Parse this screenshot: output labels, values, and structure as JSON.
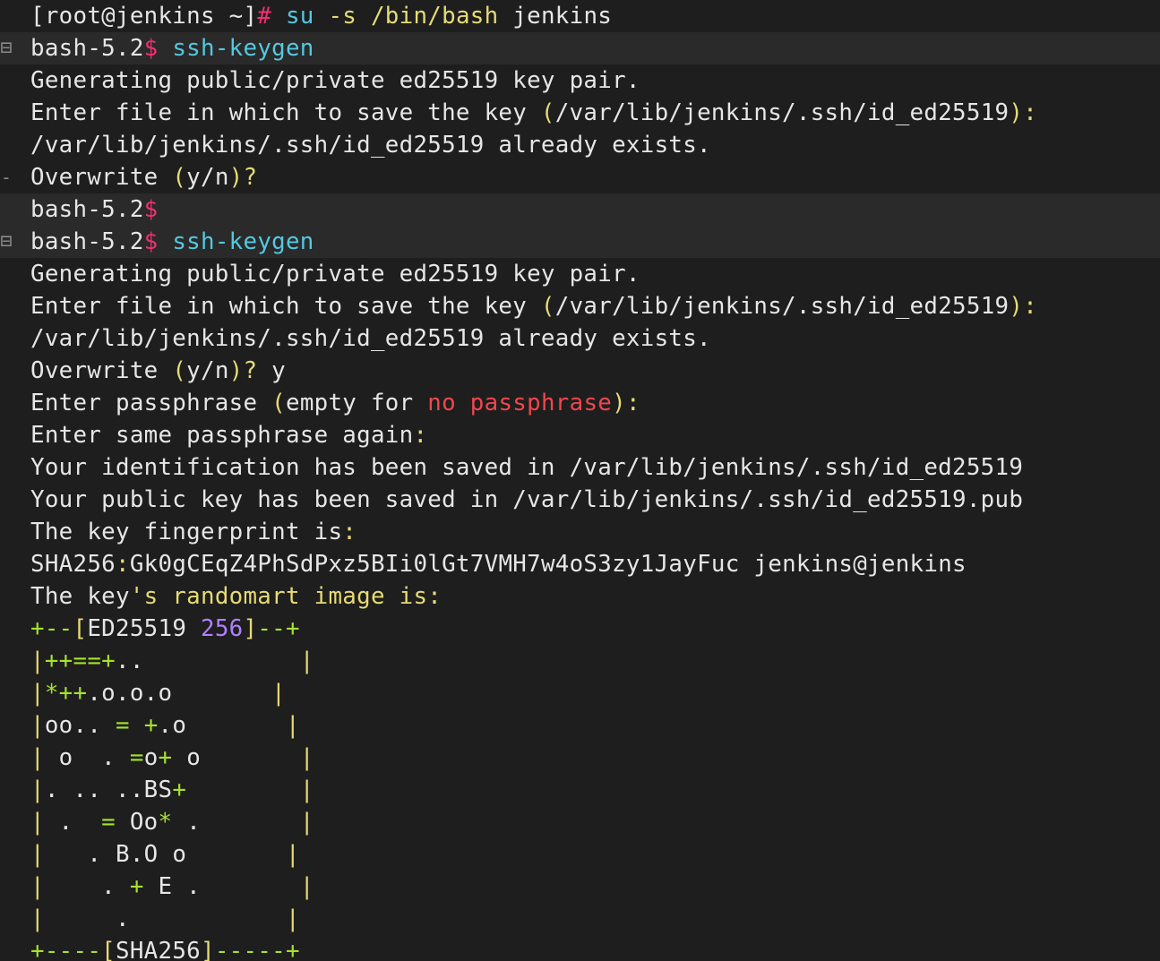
{
  "terminal": {
    "colors": {
      "background": "#1e1e1e",
      "highlight": "#2a2a2a",
      "text": "#e6e6e6",
      "prompt_symbol": "#f0306e",
      "command": "#54c8e0",
      "punctuation": "#e6db74",
      "randomart": "#a6e22e",
      "warning": "#f2464c",
      "number": "#ae81ff"
    },
    "gutter_marks": {
      "fold": "⊟",
      "dash": "-"
    },
    "lines": [
      {
        "highlight": false,
        "gutter": "",
        "segments": [
          {
            "text": "[root@jenkins ~]",
            "color": "white"
          },
          {
            "text": "#",
            "color": "pink"
          },
          {
            "text": " su ",
            "color": "cyan"
          },
          {
            "text": "-s /bin/bash",
            "color": "yellow"
          },
          {
            "text": " jenkins",
            "color": "white"
          }
        ]
      },
      {
        "highlight": true,
        "gutter": "fold",
        "segments": [
          {
            "text": "bash-5.2",
            "color": "white"
          },
          {
            "text": "$",
            "color": "pink"
          },
          {
            "text": " ssh-keygen",
            "color": "cyan"
          }
        ]
      },
      {
        "highlight": false,
        "gutter": "",
        "segments": [
          {
            "text": "Generating public/private ed25519 key pair.",
            "color": "white"
          }
        ]
      },
      {
        "highlight": false,
        "gutter": "",
        "segments": [
          {
            "text": "Enter file in which to save the key ",
            "color": "white"
          },
          {
            "text": "(",
            "color": "yellow"
          },
          {
            "text": "/var/lib/jenkins/.ssh/id_ed25519",
            "color": "white"
          },
          {
            "text": "):",
            "color": "yellow"
          }
        ]
      },
      {
        "highlight": false,
        "gutter": "",
        "segments": [
          {
            "text": "/var/lib/jenkins/.ssh/id_ed25519 already exists.",
            "color": "white"
          }
        ]
      },
      {
        "highlight": false,
        "gutter": "dash",
        "segments": [
          {
            "text": "Overwrite ",
            "color": "white"
          },
          {
            "text": "(",
            "color": "yellow"
          },
          {
            "text": "y/n",
            "color": "white"
          },
          {
            "text": ")?",
            "color": "yellow"
          }
        ]
      },
      {
        "highlight": true,
        "gutter": "",
        "segments": [
          {
            "text": "bash-5.2",
            "color": "white"
          },
          {
            "text": "$",
            "color": "pink"
          }
        ]
      },
      {
        "highlight": true,
        "gutter": "fold",
        "segments": [
          {
            "text": "bash-5.2",
            "color": "white"
          },
          {
            "text": "$",
            "color": "pink"
          },
          {
            "text": " ssh-keygen",
            "color": "cyan"
          }
        ]
      },
      {
        "highlight": false,
        "gutter": "",
        "segments": [
          {
            "text": "Generating public/private ed25519 key pair.",
            "color": "white"
          }
        ]
      },
      {
        "highlight": false,
        "gutter": "",
        "segments": [
          {
            "text": "Enter file in which to save the key ",
            "color": "white"
          },
          {
            "text": "(",
            "color": "yellow"
          },
          {
            "text": "/var/lib/jenkins/.ssh/id_ed25519",
            "color": "white"
          },
          {
            "text": "):",
            "color": "yellow"
          }
        ]
      },
      {
        "highlight": false,
        "gutter": "",
        "segments": [
          {
            "text": "/var/lib/jenkins/.ssh/id_ed25519 already exists.",
            "color": "white"
          }
        ]
      },
      {
        "highlight": false,
        "gutter": "",
        "segments": [
          {
            "text": "Overwrite ",
            "color": "white"
          },
          {
            "text": "(",
            "color": "yellow"
          },
          {
            "text": "y/n",
            "color": "white"
          },
          {
            "text": ")?",
            "color": "yellow"
          },
          {
            "text": " y",
            "color": "white"
          }
        ]
      },
      {
        "highlight": false,
        "gutter": "",
        "segments": [
          {
            "text": "Enter passphrase ",
            "color": "white"
          },
          {
            "text": "(",
            "color": "yellow"
          },
          {
            "text": "empty for ",
            "color": "white"
          },
          {
            "text": "no passphrase",
            "color": "red"
          },
          {
            "text": "):",
            "color": "yellow"
          }
        ]
      },
      {
        "highlight": false,
        "gutter": "",
        "segments": [
          {
            "text": "Enter same passphrase again",
            "color": "white"
          },
          {
            "text": ":",
            "color": "yellow"
          }
        ]
      },
      {
        "highlight": false,
        "gutter": "",
        "segments": [
          {
            "text": "Your identification has been saved in /var/lib/jenkins/.ssh/id_ed25519",
            "color": "white"
          }
        ]
      },
      {
        "highlight": false,
        "gutter": "",
        "segments": [
          {
            "text": "Your public key has been saved in /var/lib/jenkins/.ssh/id_ed25519.pub",
            "color": "white"
          }
        ]
      },
      {
        "highlight": false,
        "gutter": "",
        "segments": [
          {
            "text": "The key fingerprint is",
            "color": "white"
          },
          {
            "text": ":",
            "color": "yellow"
          }
        ]
      },
      {
        "highlight": false,
        "gutter": "",
        "segments": [
          {
            "text": "SHA256",
            "color": "white"
          },
          {
            "text": ":",
            "color": "yellow"
          },
          {
            "text": "Gk0gCEqZ4PhSdPxz5BIi0lGt7VMH7w4oS3zy1JayFuc jenkins@jenkins",
            "color": "white"
          }
        ]
      },
      {
        "highlight": false,
        "gutter": "",
        "segments": [
          {
            "text": "The key",
            "color": "white"
          },
          {
            "text": "'s randomart image is:",
            "color": "yellow"
          }
        ]
      },
      {
        "highlight": false,
        "gutter": "",
        "segments": [
          {
            "text": "+--",
            "color": "lime"
          },
          {
            "text": "[",
            "color": "yellow"
          },
          {
            "text": "ED25519 ",
            "color": "white"
          },
          {
            "text": "256",
            "color": "purple"
          },
          {
            "text": "]",
            "color": "yellow"
          },
          {
            "text": "--+",
            "color": "lime"
          }
        ]
      },
      {
        "highlight": false,
        "gutter": "",
        "segments": [
          {
            "text": "|",
            "color": "yellow"
          },
          {
            "text": "++==+",
            "color": "lime"
          },
          {
            "text": "..           ",
            "color": "white"
          },
          {
            "text": "|",
            "color": "yellow"
          }
        ]
      },
      {
        "highlight": false,
        "gutter": "",
        "segments": [
          {
            "text": "|",
            "color": "yellow"
          },
          {
            "text": "*++",
            "color": "lime"
          },
          {
            "text": ".o.o.o       ",
            "color": "white"
          },
          {
            "text": "|",
            "color": "yellow"
          }
        ]
      },
      {
        "highlight": false,
        "gutter": "",
        "segments": [
          {
            "text": "|",
            "color": "yellow"
          },
          {
            "text": "oo.. ",
            "color": "white"
          },
          {
            "text": "=",
            "color": "lime"
          },
          {
            "text": " ",
            "color": "white"
          },
          {
            "text": "+",
            "color": "lime"
          },
          {
            "text": ".o       ",
            "color": "white"
          },
          {
            "text": "|",
            "color": "yellow"
          }
        ]
      },
      {
        "highlight": false,
        "gutter": "",
        "segments": [
          {
            "text": "|",
            "color": "yellow"
          },
          {
            "text": " o  . ",
            "color": "white"
          },
          {
            "text": "=",
            "color": "lime"
          },
          {
            "text": "o",
            "color": "white"
          },
          {
            "text": "+",
            "color": "lime"
          },
          {
            "text": " o       ",
            "color": "white"
          },
          {
            "text": "|",
            "color": "yellow"
          }
        ]
      },
      {
        "highlight": false,
        "gutter": "",
        "segments": [
          {
            "text": "|",
            "color": "yellow"
          },
          {
            "text": ". .. ..BS",
            "color": "white"
          },
          {
            "text": "+",
            "color": "lime"
          },
          {
            "text": "        ",
            "color": "white"
          },
          {
            "text": "|",
            "color": "yellow"
          }
        ]
      },
      {
        "highlight": false,
        "gutter": "",
        "segments": [
          {
            "text": "|",
            "color": "yellow"
          },
          {
            "text": " .  ",
            "color": "white"
          },
          {
            "text": "=",
            "color": "lime"
          },
          {
            "text": " Oo",
            "color": "white"
          },
          {
            "text": "*",
            "color": "lime"
          },
          {
            "text": " .       ",
            "color": "white"
          },
          {
            "text": "|",
            "color": "yellow"
          }
        ]
      },
      {
        "highlight": false,
        "gutter": "",
        "segments": [
          {
            "text": "|",
            "color": "yellow"
          },
          {
            "text": "   . B.O o       ",
            "color": "white"
          },
          {
            "text": "|",
            "color": "yellow"
          }
        ]
      },
      {
        "highlight": false,
        "gutter": "",
        "segments": [
          {
            "text": "|",
            "color": "yellow"
          },
          {
            "text": "    . ",
            "color": "white"
          },
          {
            "text": "+",
            "color": "lime"
          },
          {
            "text": " E .       ",
            "color": "white"
          },
          {
            "text": "|",
            "color": "yellow"
          }
        ]
      },
      {
        "highlight": false,
        "gutter": "",
        "segments": [
          {
            "text": "|",
            "color": "yellow"
          },
          {
            "text": "     .           ",
            "color": "white"
          },
          {
            "text": "|",
            "color": "yellow"
          }
        ]
      },
      {
        "highlight": false,
        "gutter": "",
        "segments": [
          {
            "text": "+----",
            "color": "lime"
          },
          {
            "text": "[",
            "color": "yellow"
          },
          {
            "text": "SHA256",
            "color": "white"
          },
          {
            "text": "]",
            "color": "yellow"
          },
          {
            "text": "-----+",
            "color": "lime"
          }
        ]
      }
    ]
  }
}
